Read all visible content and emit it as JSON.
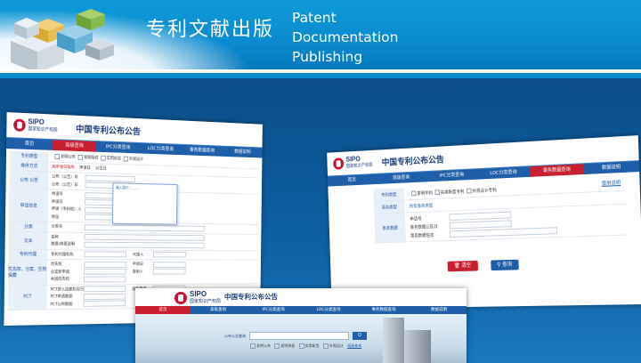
{
  "header": {
    "title_cn": "专利文献出版",
    "title_en": [
      "Patent",
      "Documentation",
      "Publishing"
    ],
    "accent": "#0a8bcf"
  },
  "site": {
    "logo_en": "SIPO",
    "logo_cn": "国家知识产权局",
    "title": "中国专利公布公告",
    "nav": [
      "首页",
      "高级查询",
      "IPC分类查询",
      "LOC分类查询",
      "事务数据查询",
      "数据说明"
    ]
  },
  "left_form": {
    "rows": [
      {
        "label": "专利类型",
        "fields": [],
        "checks": [
          "发明公布",
          "发明授权",
          "实用新型",
          "外观设计"
        ]
      },
      {
        "label": "排序方式",
        "fields": [],
        "sort": "按申请日排序",
        "sort_opts": [
          "申请日",
          "公告日"
        ]
      },
      {
        "label": "公布 公告",
        "fields": [
          "公布（公告）号",
          "公布（公告）日"
        ]
      },
      {
        "label": "申请信息",
        "fields": [
          "申请号",
          "申请日",
          "申请（专利权）人",
          "地址"
        ]
      },
      {
        "label": "分类",
        "fields": [
          "分类号"
        ]
      },
      {
        "label": "文本",
        "fields": [
          "名称",
          "摘要/简要说明"
        ]
      },
      {
        "label": "专利代理",
        "fields": [
          "专利代理机构"
        ]
      },
      {
        "label": "优先权、分案、生物保藏",
        "fields": [
          "优先权",
          "分案原申请",
          "本国优先权"
        ]
      },
      {
        "label": "PCT",
        "fields": [
          "PCT进入国家阶段日",
          "PCT申请数据",
          "PCT公布数据"
        ]
      }
    ],
    "right_fields": [
      "代理人",
      "申请日",
      "发明人",
      "国际申请"
    ],
    "tooltip": "输入提示：……"
  },
  "right_form": {
    "type_label": "专利类型",
    "type_checks": [
      "发明专利",
      "实用新型专利",
      "外观设计专利"
    ],
    "affair_label": "事务类型",
    "affair_value": "所有事务类型",
    "data_label": "事务数据",
    "data_fields": [
      "申请号",
      "事务数据公告日",
      "事务数据信息"
    ],
    "help": "使用说明",
    "clear_btn": "清空",
    "search_btn": "查询"
  },
  "bottom": {
    "search_label": "公布公告查询",
    "search_btn": "Q",
    "options": [
      "发明公布",
      "发明授权",
      "实用新型",
      "外观设计"
    ],
    "advanced": "高级查询"
  }
}
